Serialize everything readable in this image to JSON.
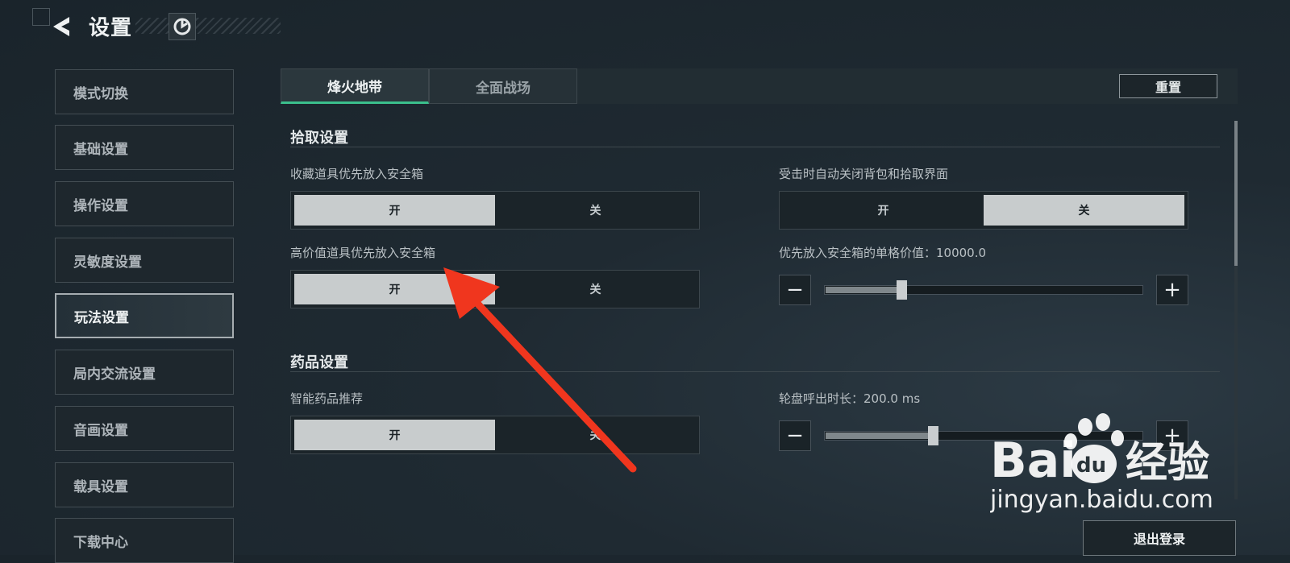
{
  "header": {
    "title": "设置",
    "icons": {
      "back": "back-arrow-icon",
      "logo": "game-logo-icon"
    }
  },
  "sidebar": {
    "items": [
      {
        "label": "模式切换",
        "active": false
      },
      {
        "label": "基础设置",
        "active": false
      },
      {
        "label": "操作设置",
        "active": false
      },
      {
        "label": "灵敏度设置",
        "active": false
      },
      {
        "label": "玩法设置",
        "active": true
      },
      {
        "label": "局内交流设置",
        "active": false
      },
      {
        "label": "音画设置",
        "active": false
      },
      {
        "label": "载具设置",
        "active": false
      },
      {
        "label": "下载中心",
        "active": false
      }
    ]
  },
  "tabs": [
    {
      "label": "烽火地带",
      "active": true
    },
    {
      "label": "全面战场",
      "active": false
    }
  ],
  "reset_label": "重置",
  "pickup": {
    "title": "拾取设置",
    "collect_safe": {
      "label": "收藏道具优先放入安全箱",
      "on": "开",
      "off": "关",
      "value": "on"
    },
    "auto_close": {
      "label": "受击时自动关闭背包和拾取界面",
      "on": "开",
      "off": "关",
      "value": "off"
    },
    "high_value_safe": {
      "label": "高价值道具优先放入安全箱",
      "on": "开",
      "off": "关",
      "value": "on"
    },
    "unit_value": {
      "label": "优先放入安全箱的单格价值：10000.0",
      "value_fraction": 0.24
    }
  },
  "medicine": {
    "title": "药品设置",
    "smart_recommend": {
      "label": "智能药品推荐",
      "on": "开",
      "off": "关",
      "value": "on"
    },
    "wheel_time": {
      "label": "轮盘呼出时长：200.0 ms",
      "value_fraction": 0.34
    }
  },
  "stepper": {
    "minus": "−",
    "plus": "+"
  },
  "logout_label": "退出登录",
  "watermark": {
    "brand_a": "Bai",
    "brand_b": "du",
    "brand_c": "经验",
    "url": "jingyan.baidu.com"
  },
  "colors": {
    "accent": "#3bbf8c",
    "annotation_arrow": "#f0361e",
    "selected": "#c8cccd"
  }
}
